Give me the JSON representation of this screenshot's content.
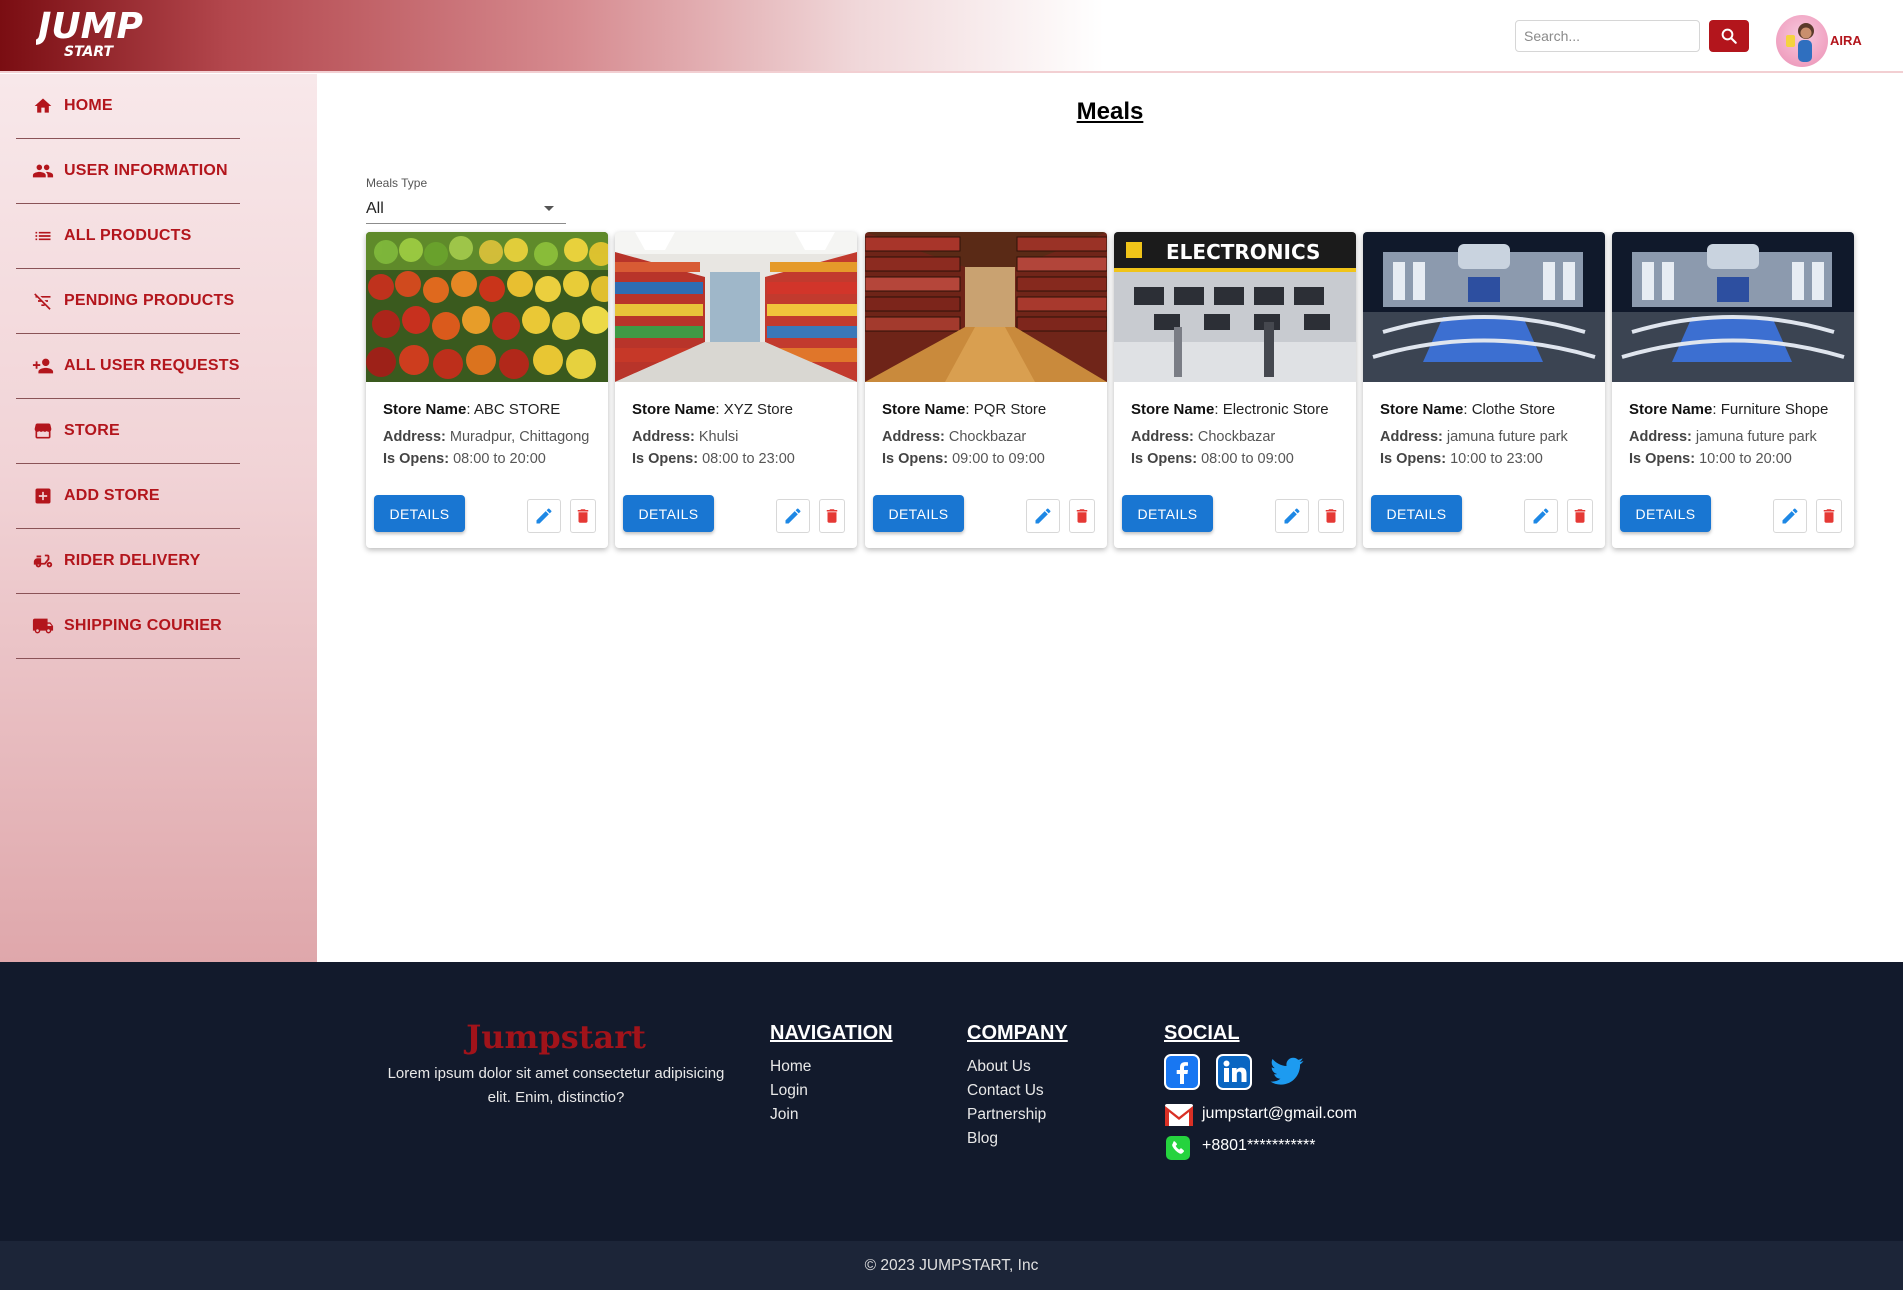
{
  "header": {
    "logo_text_top": "JUMP",
    "logo_text_bottom": "START",
    "search_placeholder": "Search...",
    "user_name": "AIRA"
  },
  "sidebar": {
    "items": [
      {
        "label": "HOME",
        "icon": "home-icon"
      },
      {
        "label": "USER INFORMATION",
        "icon": "users-icon"
      },
      {
        "label": "ALL PRODUCTS",
        "icon": "list-icon"
      },
      {
        "label": "PENDING PRODUCTS",
        "icon": "filter-off-icon"
      },
      {
        "label": "ALL USER REQUESTS",
        "icon": "add-user-icon"
      },
      {
        "label": "STORE",
        "icon": "store-icon"
      },
      {
        "label": "ADD STORE",
        "icon": "plus-box-icon"
      },
      {
        "label": "RIDER DELIVERY",
        "icon": "scooter-icon"
      },
      {
        "label": "SHIPPING COURIER",
        "icon": "truck-icon"
      }
    ]
  },
  "main": {
    "title": "Meals",
    "filter": {
      "label": "Meals Type",
      "value": "All"
    },
    "card_labels": {
      "store_name": "Store Name",
      "address": "Address:",
      "is_opens": "Is Opens:",
      "details_button": "DETAILS"
    },
    "cards": [
      {
        "store_name": "ABC STORE",
        "address": "Muradpur, Chittagong",
        "hours": "08:00 to 20:00",
        "image": "fruit-market"
      },
      {
        "store_name": "XYZ Store",
        "address": "Khulsi",
        "hours": "08:00 to 23:00",
        "image": "supermarket-aisle"
      },
      {
        "store_name": "PQR Store",
        "address": "Chockbazar",
        "hours": "09:00 to 09:00",
        "image": "bookstore"
      },
      {
        "store_name": "Electronic Store",
        "address": "Chockbazar",
        "hours": "08:00 to 09:00",
        "image": "electronics-store",
        "image_text": "ELECTRONICS"
      },
      {
        "store_name": "Clothe Store",
        "address": "jamuna future park",
        "hours": "10:00 to 23:00",
        "image": "shopping-mall-night"
      },
      {
        "store_name": "Furniture Shope",
        "address": "jamuna future park",
        "hours": "10:00 to 20:00",
        "image": "shopping-mall-night"
      }
    ]
  },
  "footer": {
    "brand": "Jumpstart",
    "description": "Lorem ipsum dolor sit amet consectetur adipisicing elit. Enim, distinctio?",
    "navigation": {
      "heading": "NAVIGATION",
      "links": [
        "Home",
        "Login",
        "Join"
      ]
    },
    "company": {
      "heading": "COMPANY",
      "links": [
        "About Us",
        "Contact Us",
        "Partnership",
        "Blog"
      ]
    },
    "social": {
      "heading": "SOCIAL",
      "icons": [
        "facebook-icon",
        "linkedin-icon",
        "twitter-icon"
      ],
      "email": "jumpstart@gmail.com",
      "phone": "+8801***********"
    },
    "copyright": "© 2023 JUMPSTART, Inc"
  },
  "colors": {
    "brand_red": "#b3151c",
    "primary_blue": "#1976d2",
    "footer_bg": "#121a2c",
    "edit_icon": "#1e88e5",
    "delete_icon": "#e53935"
  }
}
